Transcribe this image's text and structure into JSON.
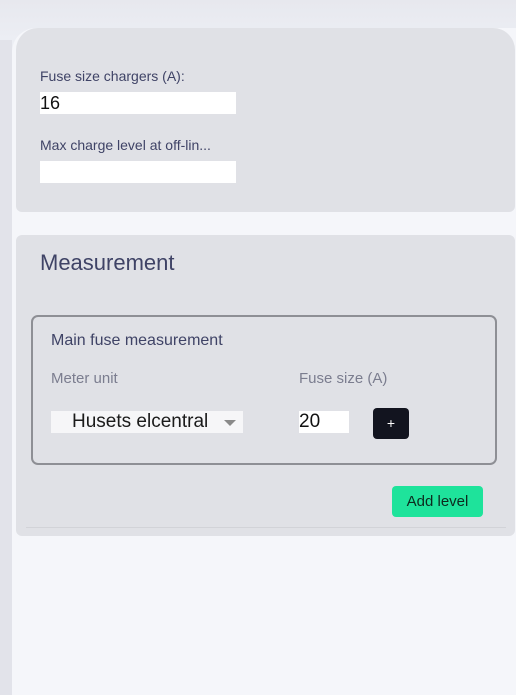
{
  "settings": {
    "fuse_size_label": "Fuse size chargers (A):",
    "fuse_size_value": "16",
    "max_charge_label": "Max charge level at off-lin...",
    "max_charge_value": ""
  },
  "measurement": {
    "title": "Measurement",
    "group": {
      "title": "Main fuse measurement",
      "meter_unit_label": "Meter unit",
      "fuse_size_label": "Fuse size (A)",
      "meter_unit_selected": "Husets elcentral",
      "fuse_size_value": "20",
      "add_button_label": "+"
    },
    "add_level_label": "Add level"
  },
  "colors": {
    "accent_green": "#1ee39b",
    "dark_button": "#12141f",
    "label_text": "#3f4366"
  },
  "icons": {
    "select_caret": "chevron-down-icon"
  }
}
